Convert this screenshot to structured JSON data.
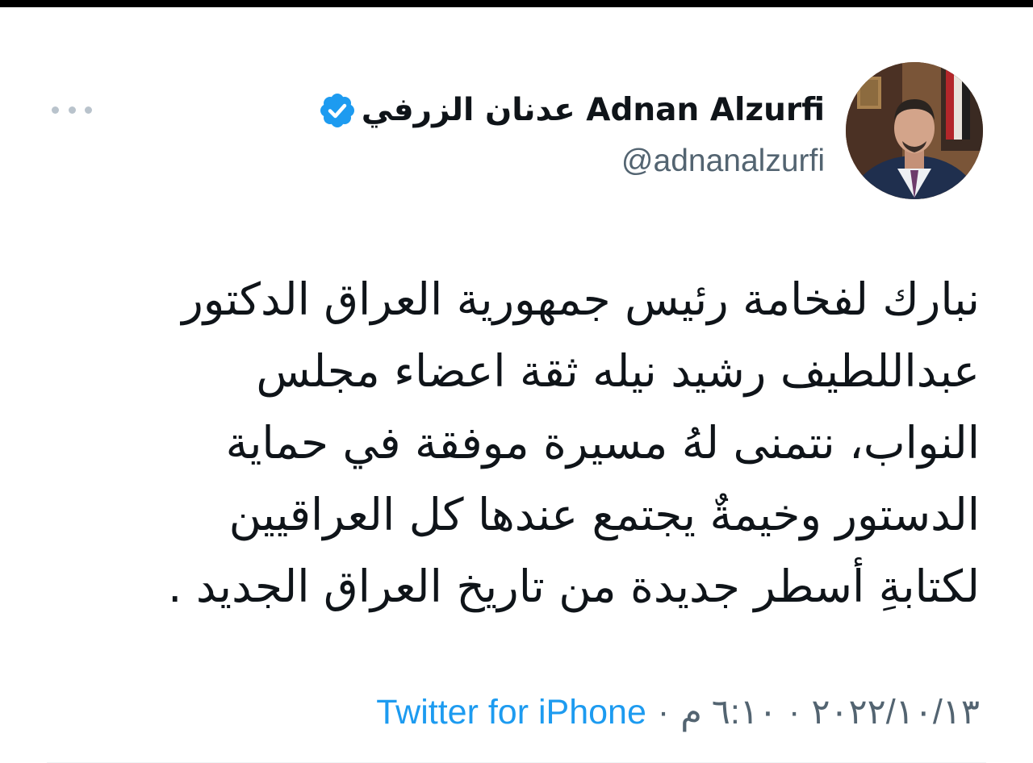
{
  "tweet": {
    "author": {
      "name": "عدنان الزرفي Adnan Alzurfi",
      "handle": "@adnanalzurfi",
      "verified": true
    },
    "text_lines": [
      "نبارك لفخامة رئيس جمهورية العراق الدكتور",
      "عبداللطيف رشيد نيله ثقة اعضاء مجلس",
      "النواب، نتمنى لهُ مسيرة موفقة في حماية",
      "الدستور وخيمةٌ يجتمع عندها كل العراقيين",
      "لكتابةِ أسطر جديدة من تاريخ العراق الجديد ."
    ],
    "meta": {
      "date": "٢٠٢٢/١٠/١٣",
      "separator": "·",
      "time": "٦:١٠ م",
      "source": "Twitter for iPhone"
    }
  },
  "icons": {
    "more": "more-dots-icon",
    "verified": "verified-badge-icon",
    "avatar": "profile-photo"
  },
  "colors": {
    "text_primary": "#0f1419",
    "text_secondary": "#536471",
    "accent_blue": "#1d9bf0",
    "more_dots": "#b9c3cc"
  }
}
